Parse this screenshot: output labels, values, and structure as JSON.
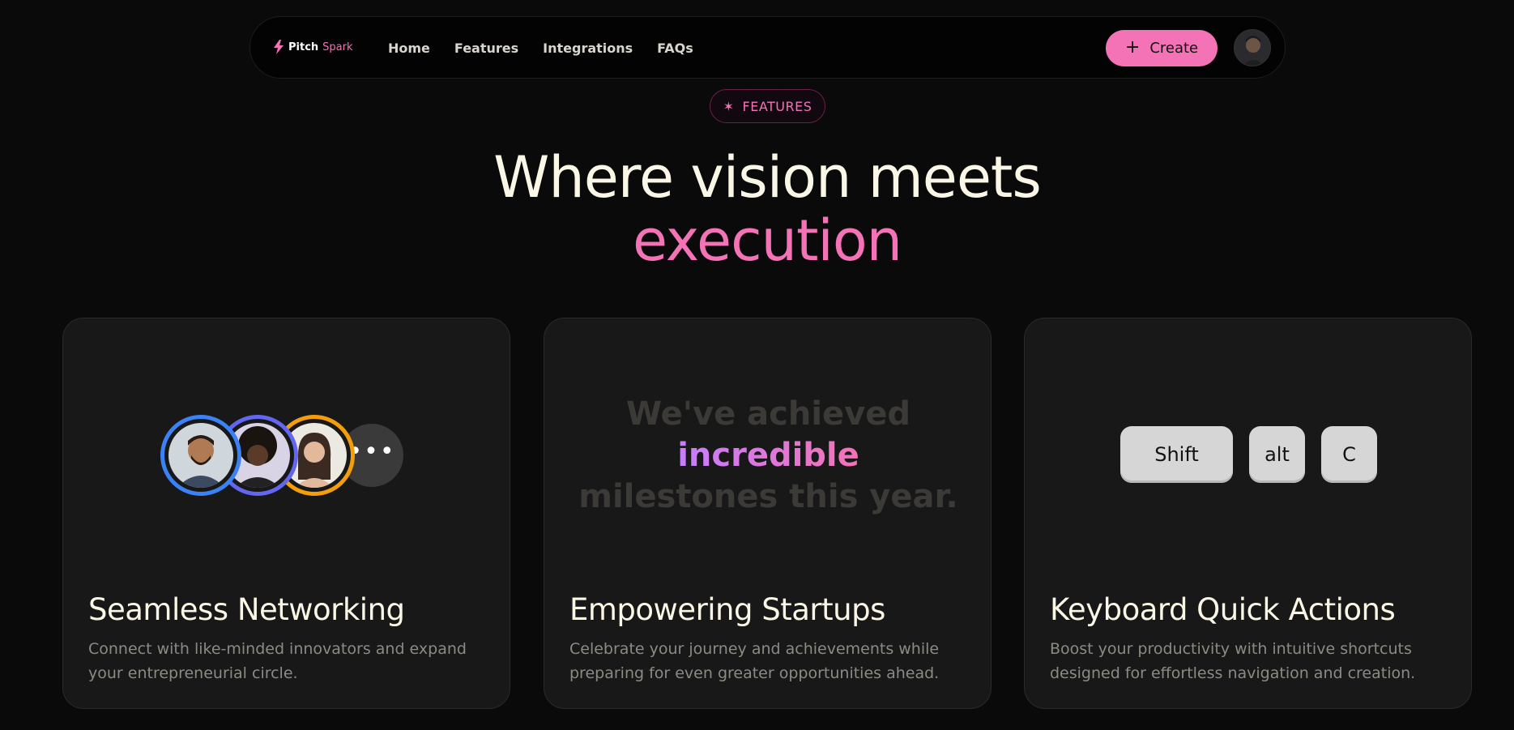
{
  "nav": {
    "logo_part1": "Pitch",
    "logo_part2": "Spark",
    "links": [
      "Home",
      "Features",
      "Integrations",
      "FAQs"
    ],
    "create_label": "Create"
  },
  "badge": {
    "label": "FEATURES"
  },
  "headline": {
    "line1": "Where vision meets",
    "line2": "execution"
  },
  "cards": [
    {
      "title": "Seamless Networking",
      "description": "Connect with like-minded innovators and expand your entrepreneurial circle.",
      "more_label": "•••"
    },
    {
      "title": "Empowering Startups",
      "description": "Celebrate your journey and achievements while preparing for even greater opportunities ahead.",
      "quote_before": "We've achieved",
      "quote_highlight": "incredible",
      "quote_after": "milestones this year."
    },
    {
      "title": "Keyboard Quick Actions",
      "description": "Boost your productivity with intuitive shortcuts designed for effortless navigation and creation.",
      "keys": [
        "Shift",
        "alt",
        "C"
      ]
    }
  ],
  "colors": {
    "accent": "#f472b6",
    "background": "#0a0a0b",
    "card": "#181818",
    "heading": "#fbf7e6",
    "avatar_ring_1": "#3b82f6",
    "avatar_ring_2": "#6366f1",
    "avatar_ring_3": "#f59e0b"
  }
}
